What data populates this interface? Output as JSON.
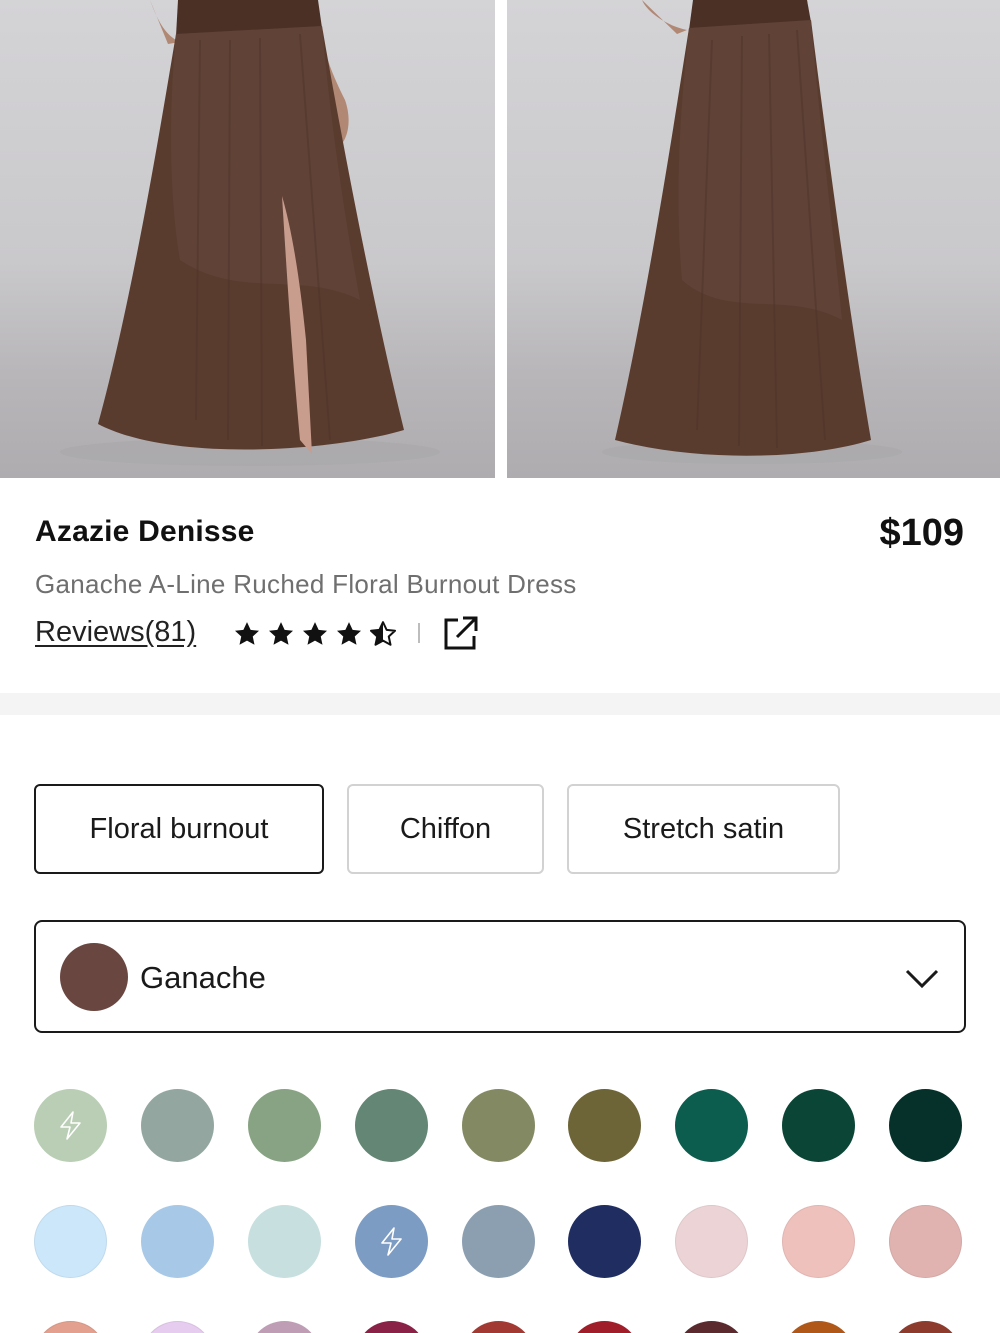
{
  "product": {
    "brand": "Azazie Denisse",
    "price": "$109",
    "subtitle": "Ganache A-Line Ruched Floral Burnout Dress",
    "reviews_label": "Reviews(81)",
    "rating": 4.5,
    "rating_max": 5
  },
  "gallery": {
    "images": [
      {
        "alt": "front-view-photo"
      },
      {
        "alt": "back-view-photo"
      }
    ],
    "dress_color": "#5a3c2f"
  },
  "fabric_tabs": [
    {
      "label": "Floral burnout",
      "active": true
    },
    {
      "label": "Chiffon",
      "active": false
    },
    {
      "label": "Stretch satin",
      "active": false
    }
  ],
  "color_select": {
    "selected_label": "Ganache",
    "selected_color": "#6a4640"
  },
  "swatches": {
    "row1": [
      {
        "color": "#b9ceb4",
        "quick_ship": true
      },
      {
        "color": "#93a7a0",
        "quick_ship": false
      },
      {
        "color": "#88a383",
        "quick_ship": false
      },
      {
        "color": "#648674",
        "quick_ship": false
      },
      {
        "color": "#838a63",
        "quick_ship": false
      },
      {
        "color": "#6d6438",
        "quick_ship": false
      },
      {
        "color": "#0d5d4f",
        "quick_ship": false
      },
      {
        "color": "#0a4536",
        "quick_ship": false
      },
      {
        "color": "#06302a",
        "quick_ship": false
      }
    ],
    "row2": [
      {
        "color": "#cde7fa",
        "quick_ship": false
      },
      {
        "color": "#a7c8e6",
        "quick_ship": false
      },
      {
        "color": "#c7dfdf",
        "quick_ship": false
      },
      {
        "color": "#7c9cc3",
        "quick_ship": true
      },
      {
        "color": "#8c9fb1",
        "quick_ship": false
      },
      {
        "color": "#1f2d60",
        "quick_ship": false
      },
      {
        "color": "#ecd4d6",
        "quick_ship": false
      },
      {
        "color": "#eec1bd",
        "quick_ship": false
      },
      {
        "color": "#e0b3b0",
        "quick_ship": false
      }
    ],
    "row3": [
      {
        "color": "#e3a08e",
        "quick_ship": false
      },
      {
        "color": "#e6ccef",
        "quick_ship": false
      },
      {
        "color": "#bf9db4",
        "quick_ship": false
      },
      {
        "color": "#8a2248",
        "quick_ship": false
      },
      {
        "color": "#a23a33",
        "quick_ship": false
      },
      {
        "color": "#a01d2a",
        "quick_ship": false
      },
      {
        "color": "#5b2a2e",
        "quick_ship": false
      },
      {
        "color": "#b0581a",
        "quick_ship": false
      },
      {
        "color": "#8d3b2d",
        "quick_ship": false
      }
    ]
  },
  "icons": {
    "star": "star-icon",
    "share": "external-link-icon",
    "chevron": "chevron-down-icon",
    "quick_ship": "lightning-icon"
  }
}
